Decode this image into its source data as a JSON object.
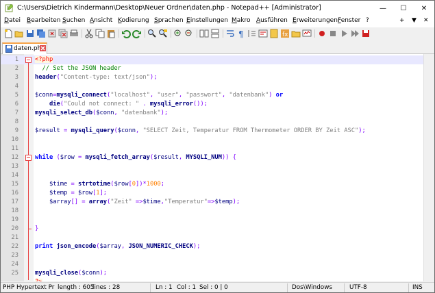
{
  "window": {
    "title": "C:\\Users\\Dietrich Kindermann\\Desktop\\Neuer Ordner\\daten.php - Notepad++ [Administrator]",
    "minimize_glyph": "—",
    "maximize_glyph": "☐",
    "close_glyph": "✕"
  },
  "menu": {
    "items": [
      "Datei",
      "Bearbeiten",
      "Suchen",
      "Ansicht",
      "Kodierung",
      "Sprachen",
      "Einstellungen",
      "Makro",
      "Ausführen",
      "Erweiterungen",
      "Fenster",
      "?"
    ],
    "extra": [
      "+",
      "▼",
      "✕"
    ]
  },
  "tabs": [
    {
      "label": "daten.php",
      "active": true
    }
  ],
  "editor": {
    "line_numbers": [
      "1",
      "2",
      "3",
      "4",
      "5",
      "6",
      "7",
      "8",
      "9",
      "10",
      "11",
      "12",
      "13",
      "14",
      "15",
      "16",
      "17",
      "18",
      "19",
      "20",
      "21",
      "22",
      "23",
      "24",
      "25"
    ],
    "current_line": 1
  },
  "status": {
    "language": "PHP Hypertext Pr",
    "length": "length : 605",
    "lines": "lines : 28",
    "ln": "Ln : 1",
    "col": "Col : 1",
    "sel": "Sel : 0 | 0",
    "eol": "Dos\\Windows",
    "encoding": "UTF-8",
    "mode": "INS"
  },
  "colors": {
    "accent_tab": "#f7a347",
    "fold_marker": "#e84040",
    "current_line": "#e8e8ff"
  }
}
